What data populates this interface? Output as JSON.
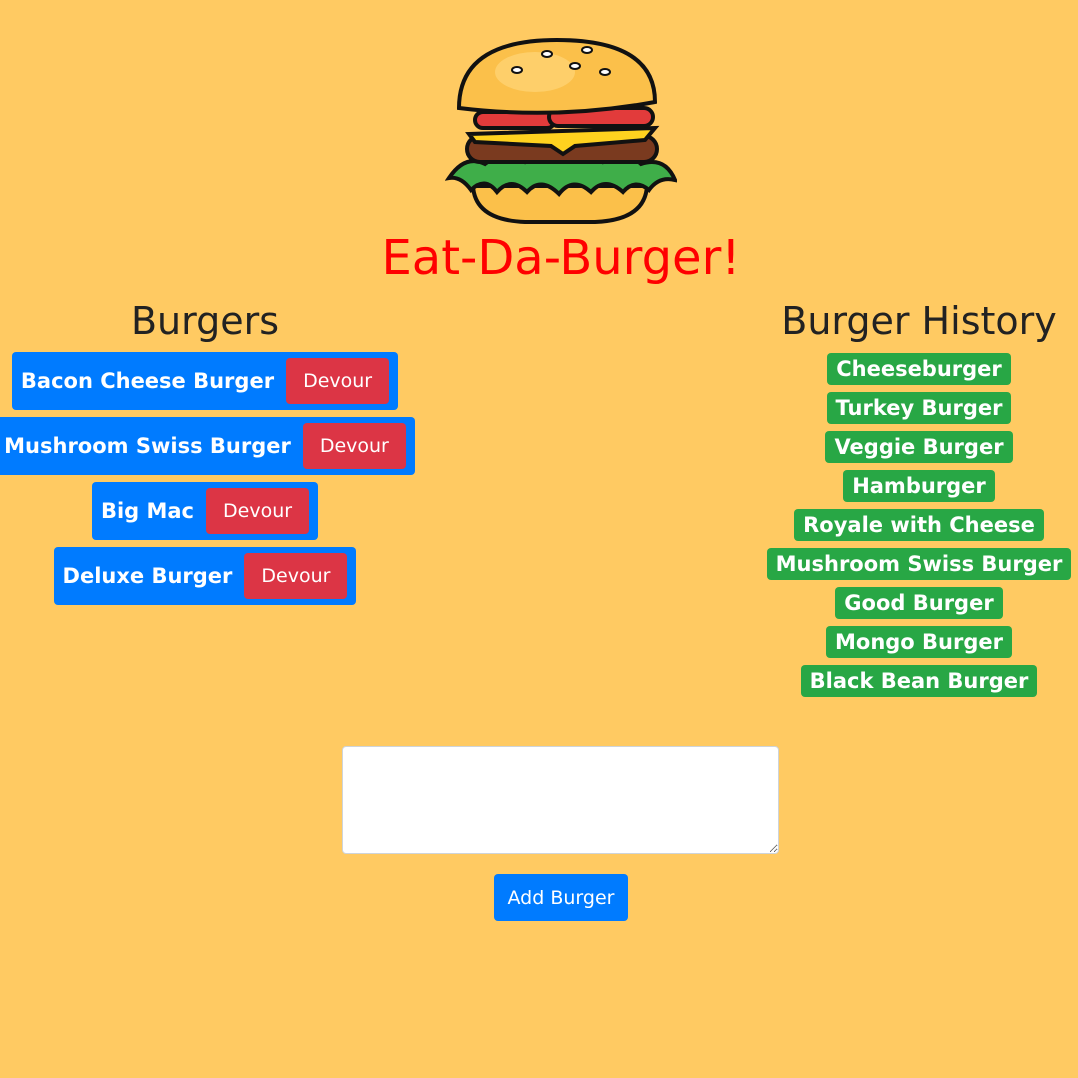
{
  "app": {
    "title": "Eat-Da-Burger!",
    "logo_icon": "burger-logo-icon"
  },
  "burgers": {
    "heading": "Burgers",
    "devour_label": "Devour",
    "items": [
      {
        "name": "Bacon Cheese Burger"
      },
      {
        "name": "Mushroom Swiss Burger"
      },
      {
        "name": "Big Mac"
      },
      {
        "name": "Deluxe Burger"
      }
    ]
  },
  "history": {
    "heading": "Burger History",
    "items": [
      "Cheeseburger",
      "Turkey Burger",
      "Veggie Burger",
      "Hamburger",
      "Royale with Cheese",
      "Mushroom Swiss Burger",
      "Good Burger",
      "Mongo Burger",
      "Black Bean Burger"
    ]
  },
  "form": {
    "textarea_value": "",
    "add_label": "Add Burger"
  },
  "colors": {
    "background": "#ffca62",
    "title": "#ff0000",
    "primary": "#007bff",
    "danger": "#dc3545",
    "success": "#28a745"
  }
}
